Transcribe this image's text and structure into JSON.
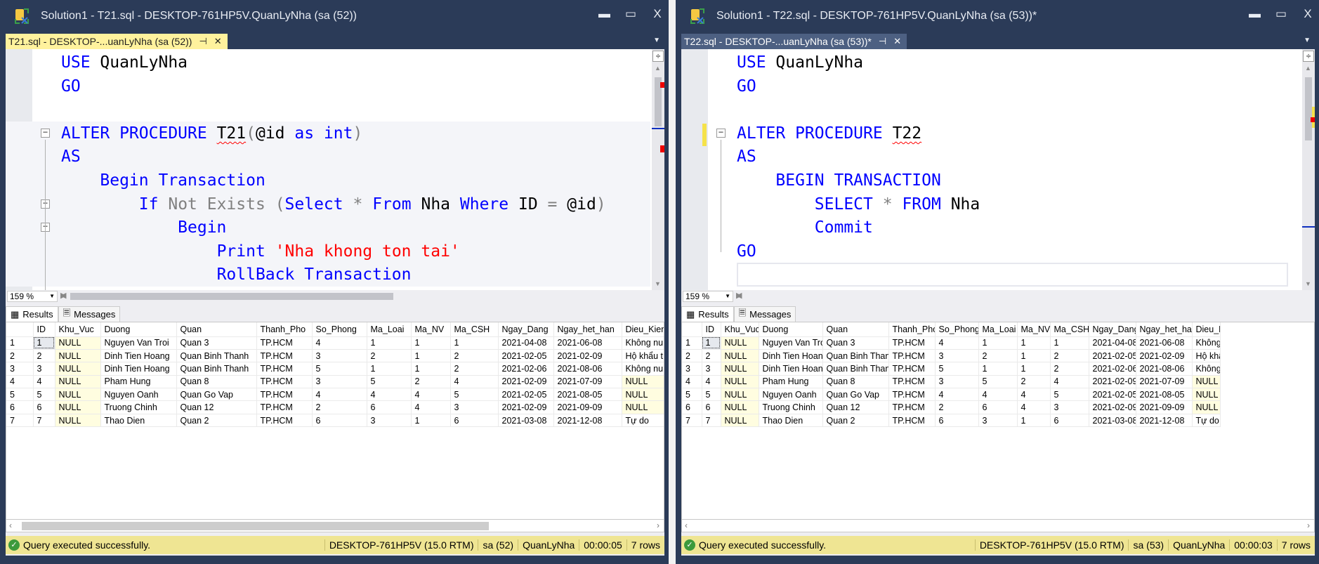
{
  "windows": [
    {
      "title": "Solution1 - T21.sql - DESKTOP-761HP5V.QuanLyNha (sa (52))",
      "tab_label": "T21.sql - DESKTOP-...uanLyNha (sa (52))",
      "zoom": "159 %",
      "code": [
        [
          [
            "USE",
            "kw"
          ],
          [
            " ",
            ""
          ],
          [
            "QuanLyNha",
            "id"
          ]
        ],
        [
          [
            "GO",
            "kw"
          ]
        ],
        [],
        [
          [
            "ALTER PROCEDURE",
            "kw"
          ],
          [
            " ",
            ""
          ],
          [
            "T21",
            "id squig"
          ],
          [
            "(",
            "gr"
          ],
          [
            "@id",
            "id"
          ],
          [
            " ",
            ""
          ],
          [
            "as",
            "kw"
          ],
          [
            " ",
            ""
          ],
          [
            "int",
            "kw"
          ],
          [
            ")",
            "gr"
          ]
        ],
        [
          [
            "AS",
            "kw"
          ]
        ],
        [
          [
            "    ",
            ""
          ],
          [
            "Begin Transaction",
            "kw"
          ]
        ],
        [
          [
            "        ",
            ""
          ],
          [
            "If",
            "kw"
          ],
          [
            " ",
            ""
          ],
          [
            "Not Exists",
            "gr"
          ],
          [
            " ",
            ""
          ],
          [
            "(",
            "gr"
          ],
          [
            "Select",
            "kw"
          ],
          [
            " ",
            ""
          ],
          [
            "*",
            "gr"
          ],
          [
            " ",
            ""
          ],
          [
            "From",
            "kw"
          ],
          [
            " ",
            ""
          ],
          [
            "Nha",
            "id"
          ],
          [
            " ",
            ""
          ],
          [
            "Where",
            "kw"
          ],
          [
            " ",
            ""
          ],
          [
            "ID",
            "id"
          ],
          [
            " ",
            ""
          ],
          [
            "=",
            "gr"
          ],
          [
            " ",
            ""
          ],
          [
            "@id",
            "id"
          ],
          [
            ")",
            "gr"
          ]
        ],
        [
          [
            "            ",
            ""
          ],
          [
            "Begin",
            "kw"
          ]
        ],
        [
          [
            "                ",
            ""
          ],
          [
            "Print",
            "kw"
          ],
          [
            " ",
            ""
          ],
          [
            "'Nha khong ton tai'",
            "str"
          ]
        ],
        [
          [
            "                ",
            ""
          ],
          [
            "RollBack Transaction",
            "kw"
          ]
        ]
      ],
      "results_tab": "Results",
      "messages_tab": "Messages",
      "status": {
        "message": "Query executed successfully.",
        "server": "DESKTOP-761HP5V (15.0 RTM)",
        "user": "sa (52)",
        "database": "QuanLyNha",
        "elapsed": "00:00:05",
        "rows": "7 rows"
      }
    },
    {
      "title": "Solution1 - T22.sql - DESKTOP-761HP5V.QuanLyNha (sa (53))*",
      "tab_label": "T22.sql - DESKTOP-...uanLyNha (sa (53))*",
      "zoom": "159 %",
      "code": [
        [
          [
            "USE",
            "kw"
          ],
          [
            " ",
            ""
          ],
          [
            "QuanLyNha",
            "id"
          ]
        ],
        [
          [
            "GO",
            "kw"
          ]
        ],
        [],
        [
          [
            "ALTER PROCEDURE",
            "kw"
          ],
          [
            " ",
            ""
          ],
          [
            "T22",
            "id squig"
          ]
        ],
        [
          [
            "AS",
            "kw"
          ]
        ],
        [
          [
            "    ",
            ""
          ],
          [
            "BEGIN TRANSACTION",
            "kw"
          ]
        ],
        [
          [
            "        ",
            ""
          ],
          [
            "SELECT",
            "kw"
          ],
          [
            " ",
            ""
          ],
          [
            "*",
            "gr"
          ],
          [
            " ",
            ""
          ],
          [
            "FROM",
            "kw"
          ],
          [
            " ",
            ""
          ],
          [
            "Nha",
            "id"
          ]
        ],
        [
          [
            "        ",
            ""
          ],
          [
            "Commit",
            "kw"
          ]
        ],
        [
          [
            "GO",
            "kw"
          ]
        ],
        []
      ],
      "results_tab": "Results",
      "messages_tab": "Messages",
      "status": {
        "message": "Query executed successfully.",
        "server": "DESKTOP-761HP5V (15.0 RTM)",
        "user": "sa (53)",
        "database": "QuanLyNha",
        "elapsed": "00:00:03",
        "rows": "7 rows"
      }
    }
  ],
  "grid": {
    "columns": [
      "",
      "ID",
      "Khu_Vuc",
      "Duong",
      "Quan",
      "Thanh_Pho",
      "So_Phong",
      "Ma_Loai",
      "Ma_NV",
      "Ma_CSH",
      "Ngay_Dang",
      "Ngay_het_han",
      "Dieu_Kien"
    ],
    "rows": [
      [
        "1",
        "1",
        "NULL",
        "Nguyen Van Troi",
        "Quan 3",
        "TP.HCM",
        "4",
        "1",
        "1",
        "1",
        "2021-04-08",
        "2021-06-08",
        "Không nu"
      ],
      [
        "2",
        "2",
        "NULL",
        "Dinh Tien Hoang",
        "Quan Binh Thanh",
        "TP.HCM",
        "3",
        "2",
        "1",
        "2",
        "2021-02-05",
        "2021-02-09",
        "Hộ khẩu t"
      ],
      [
        "3",
        "3",
        "NULL",
        "Dinh Tien Hoang",
        "Quan Binh Thanh",
        "TP.HCM",
        "5",
        "1",
        "1",
        "2",
        "2021-02-06",
        "2021-08-06",
        "Không nu"
      ],
      [
        "4",
        "4",
        "NULL",
        "Pham Hung",
        "Quan 8",
        "TP.HCM",
        "3",
        "5",
        "2",
        "4",
        "2021-02-09",
        "2021-07-09",
        "NULL"
      ],
      [
        "5",
        "5",
        "NULL",
        "Nguyen Oanh",
        "Quan Go Vap",
        "TP.HCM",
        "4",
        "4",
        "4",
        "5",
        "2021-02-05",
        "2021-08-05",
        "NULL"
      ],
      [
        "6",
        "6",
        "NULL",
        "Truong Chinh",
        "Quan 12",
        "TP.HCM",
        "2",
        "6",
        "4",
        "3",
        "2021-02-09",
        "2021-09-09",
        "NULL"
      ],
      [
        "7",
        "7",
        "NULL",
        "Thao Dien",
        "Quan 2",
        "TP.HCM",
        "6",
        "3",
        "1",
        "6",
        "2021-03-08",
        "2021-12-08",
        "Tự do"
      ]
    ]
  },
  "colors": {
    "keyword": "#0000ff",
    "string": "#ff0000",
    "status_bar": "#efe593",
    "title_bar": "#2b3b58",
    "active_tab": "#fff29d"
  }
}
